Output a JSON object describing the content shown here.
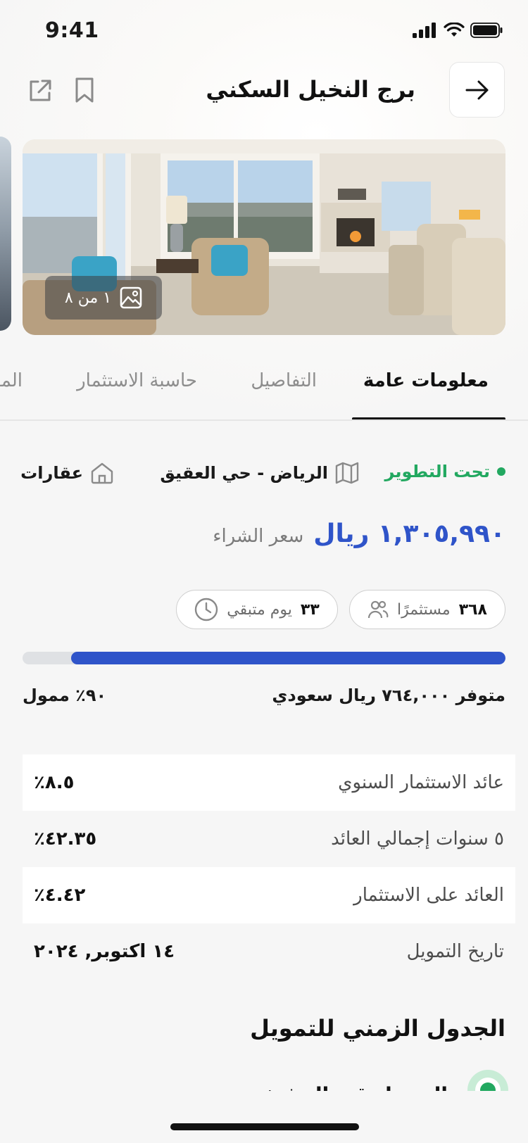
{
  "status_bar": {
    "time": "9:41"
  },
  "header": {
    "title": "برج النخيل السكني",
    "back_icon": "arrow-right-icon",
    "bookmark_icon": "bookmark-icon",
    "share_icon": "share-icon"
  },
  "gallery": {
    "counter_text": "١ من ٨",
    "counter_icon": "image-icon"
  },
  "tabs": [
    {
      "label": "معلومات عامة",
      "active": true
    },
    {
      "label": "التفاصيل",
      "active": false
    },
    {
      "label": "حاسبة الاستثمار",
      "active": false
    },
    {
      "label": "المس",
      "active": false
    }
  ],
  "property_meta": {
    "status": "تحت التطوير",
    "status_color": "#22a860",
    "location": "الرياض - حي العقيق",
    "location_icon": "map-icon",
    "category": "عقارات",
    "category_icon": "home-icon"
  },
  "price": {
    "value": "١,٣٠٥,٩٩٠ ريال",
    "label": "سعر الشراء",
    "color": "#2f54c9"
  },
  "pills": {
    "investors_count": "٣٦٨",
    "investors_label": "مستثمرًا",
    "investors_icon": "users-icon",
    "days_count": "٣٣",
    "days_label": "يوم متبقي",
    "days_icon": "clock-icon"
  },
  "funding": {
    "progress": 0.9,
    "available_text": "متوفر ٧٦٤,٠٠٠ ريال سعودي",
    "funded_text": "٩٠٪ ممول"
  },
  "stats": [
    {
      "label": "عائد الاستثمار السنوي",
      "value": "٨.٥٪"
    },
    {
      "label": "٥ سنوات إجمالي العائد",
      "value": "٤٢.٣٥٪"
    },
    {
      "label": "العائد على الاستثمار",
      "value": "٤.٤٢٪"
    },
    {
      "label": "تاريخ التمويل",
      "value": "١٤ اكتوبر, ٢٠٢٤"
    }
  ],
  "timeline": {
    "title": "الجدول الزمني للتمويل",
    "first_item": "التمويل قيد التنفيذ"
  }
}
